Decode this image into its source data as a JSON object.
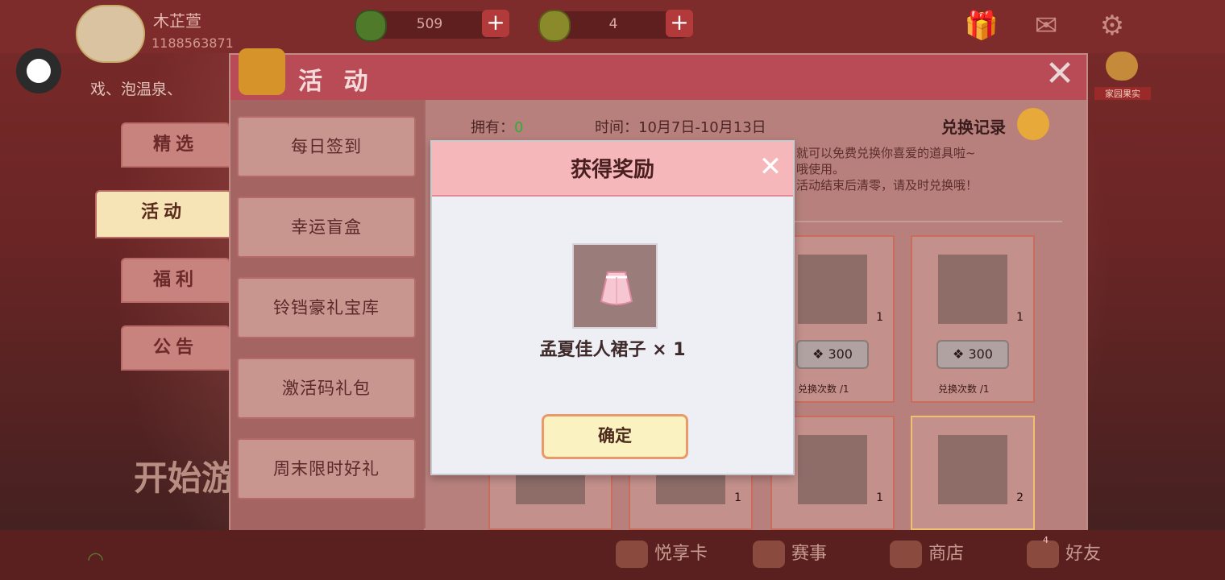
{
  "top_bar": {
    "username": "木芷萱",
    "user_id": "1188563871",
    "gem_count": "509",
    "coin_count": "4"
  },
  "marquee": "戏、泡温泉、",
  "home_fruit_label": "家园果实",
  "start_text": "开始游",
  "side_tabs": [
    "精选",
    "活动",
    "福利",
    "公告"
  ],
  "panel": {
    "title": "活 动",
    "menu": [
      "每日签到",
      "幸运盲盒",
      "铃铛豪礼宝库",
      "激活码礼包",
      "周末限时好礼"
    ],
    "owned_label": "拥有：",
    "owned_value": "0",
    "time_label": "时间：10月7日-10月13日",
    "record_label": "兑换记录",
    "desc_lines": [
      "就可以免费兑换你喜爱的道具啦~",
      "哦使用。",
      "活动结束后清零，请及时兑换哦！"
    ],
    "cards": [
      {
        "count": "1",
        "cost": "300",
        "times": "兑换次数 /1"
      },
      {
        "count": "1",
        "cost": "300",
        "times": "兑换次数 /1"
      },
      {
        "count": "1"
      },
      {
        "count": "2"
      },
      {
        "count": "1"
      }
    ]
  },
  "bottom_bar": {
    "items": [
      "悦享卡",
      "赛事",
      "商店",
      "好友"
    ],
    "friend_badge": "4"
  },
  "dialog": {
    "title": "获得奖励",
    "reward_name": "孟夏佳人裙子 × 1",
    "confirm_label": "确定"
  },
  "colors": {
    "accent_pink": "#f6b7bb",
    "panel_red": "#b84b55",
    "confirm_bg": "#fbf2c2",
    "owned_green": "#2fae3a"
  }
}
